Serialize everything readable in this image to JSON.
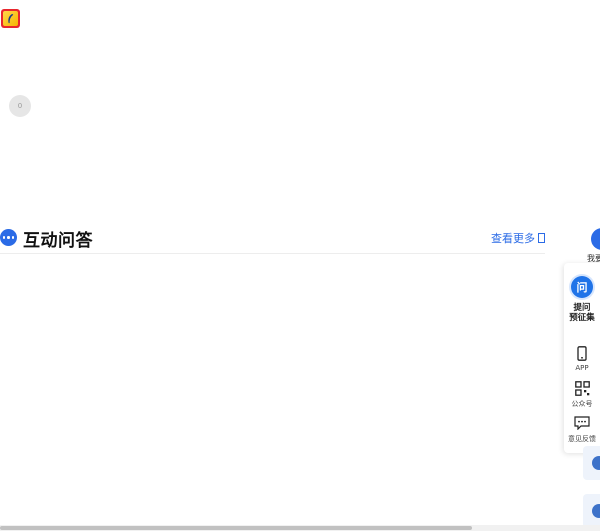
{
  "logo": {
    "icon": "app-logo-icon",
    "border_color": "#e8262d",
    "fill_color": "#f6b400"
  },
  "avatar": {
    "icon": "user-avatar-icon",
    "text": "0"
  },
  "qa_section": {
    "icon": "chat-bubble-icon",
    "title": "互动问答",
    "more_label": "查看更多",
    "accent": "#2b6be6"
  },
  "sidebar": {
    "top_partial_label": "我要",
    "ask": {
      "icon_text": "问",
      "label_line1": "提问",
      "label_line2": "预征集"
    },
    "items": [
      {
        "icon": "mobile-phone-icon",
        "label": "APP"
      },
      {
        "icon": "qr-code-icon",
        "label": "公众号"
      },
      {
        "icon": "feedback-icon",
        "label": "意见反馈"
      }
    ]
  }
}
